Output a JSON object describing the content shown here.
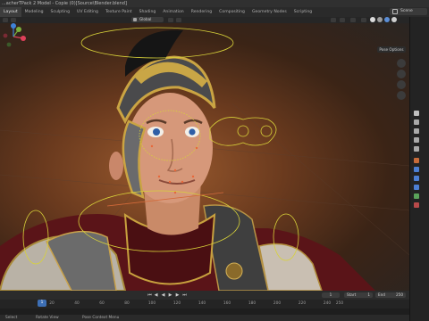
{
  "window": {
    "title": "...acherTPack 2 Model - Copie (0)[Source\\Blender.blend]"
  },
  "workspace_tabs": [
    {
      "label": "Layout",
      "active": true
    },
    {
      "label": "Modeling"
    },
    {
      "label": "Sculpting"
    },
    {
      "label": "UV Editing"
    },
    {
      "label": "Texture Paint"
    },
    {
      "label": "Shading"
    },
    {
      "label": "Animation"
    },
    {
      "label": "Rendering"
    },
    {
      "label": "Compositing"
    },
    {
      "label": "Geometry Nodes"
    },
    {
      "label": "Scripting"
    }
  ],
  "scene": {
    "label": "Scene"
  },
  "header": {
    "mode": "Global",
    "pose_options": "Pose Options"
  },
  "gizmo": {
    "x": "X",
    "y": "Y",
    "z": "Z"
  },
  "timeline": {
    "current_frame": "1",
    "start_label": "Start",
    "start_value": "1",
    "end_label": "End",
    "end_value": "250",
    "ruler_ticks": [
      "20",
      "40",
      "60",
      "80",
      "100",
      "120",
      "140",
      "160",
      "180",
      "200",
      "220",
      "240",
      "250"
    ],
    "playhead": "1"
  },
  "status": {
    "left": "Select",
    "middle": "Rotate View",
    "right": "Pose Context Menu"
  },
  "colors": {
    "viewport_warm": "#9a5a2e",
    "rig_yellow": "#d8d23a",
    "accent_blue": "#3d6fb5",
    "gizmo_x": "#e0405a",
    "gizmo_y": "#7ab03c",
    "gizmo_z": "#3f82d8"
  }
}
